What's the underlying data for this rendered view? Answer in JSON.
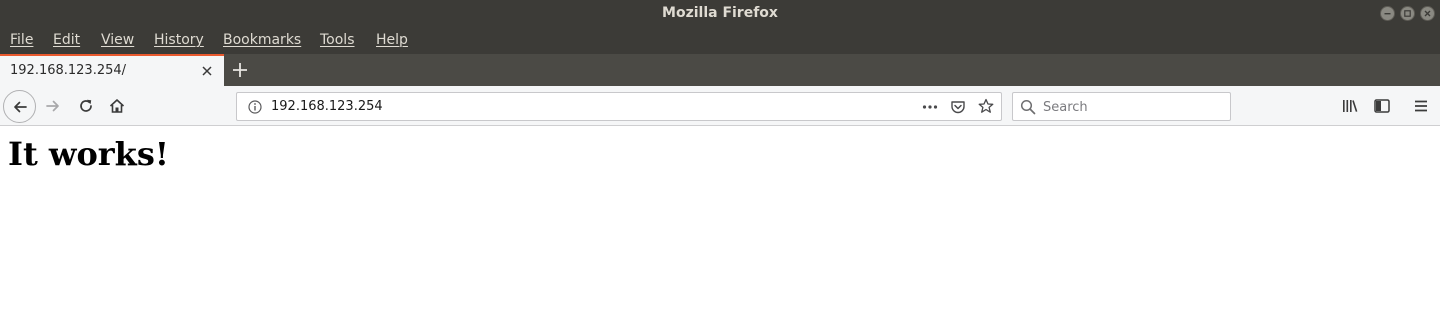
{
  "window": {
    "title": "Mozilla Firefox"
  },
  "menubar": {
    "items": [
      "File",
      "Edit",
      "View",
      "History",
      "Bookmarks",
      "Tools",
      "Help"
    ]
  },
  "tabs": [
    {
      "label": "192.168.123.254/",
      "active": true
    }
  ],
  "navbar": {
    "url": "192.168.123.254",
    "search_placeholder": "Search"
  },
  "page": {
    "heading": "It works!"
  },
  "colors": {
    "titlebar": "#3c3b37",
    "tabstrip": "#4b4a45",
    "active_tab_accent": "#ea5a2f",
    "toolbar": "#f5f6f7"
  },
  "icons": [
    "minimize-icon",
    "maximize-icon",
    "close-icon",
    "tab-close-icon",
    "new-tab-icon",
    "back-arrow-icon",
    "forward-arrow-icon",
    "reload-icon",
    "home-icon",
    "site-info-icon",
    "page-actions-icon",
    "pocket-icon",
    "bookmark-star-icon",
    "search-icon",
    "library-icon",
    "sidebar-icon",
    "hamburger-menu-icon"
  ]
}
